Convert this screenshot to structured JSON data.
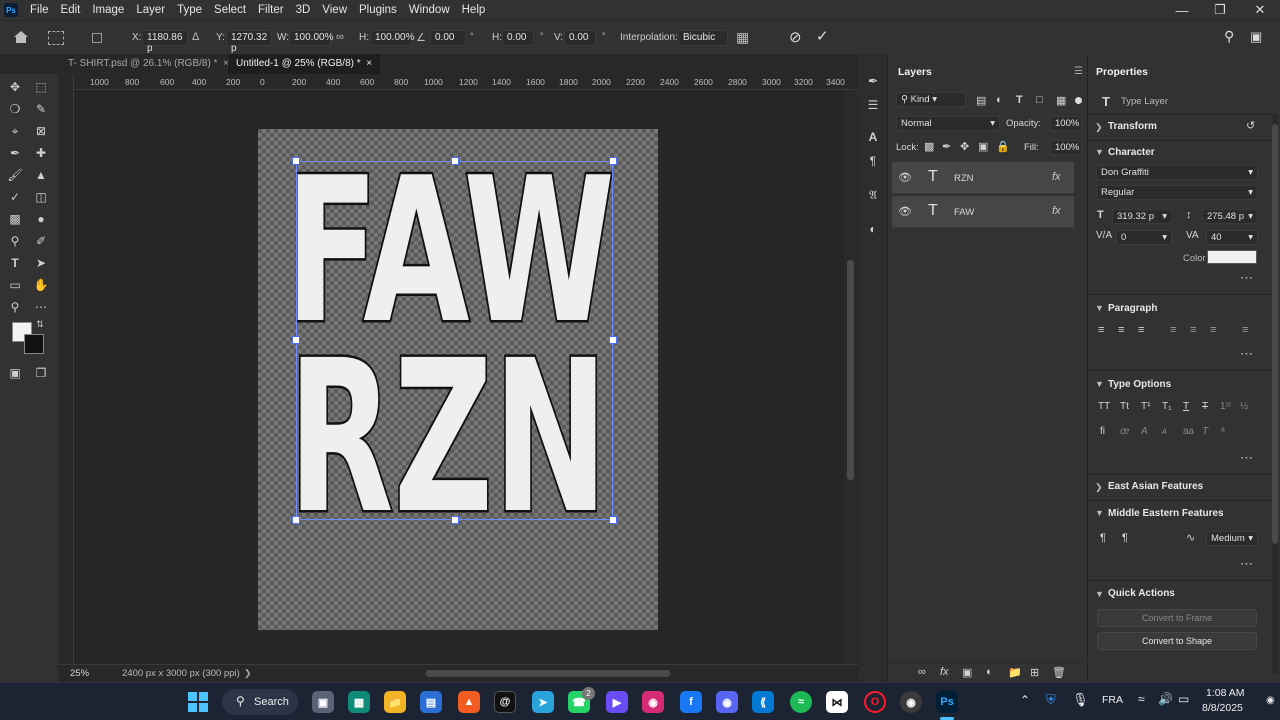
{
  "app": {
    "logo_text": "Ps"
  },
  "menu": [
    "File",
    "Edit",
    "Image",
    "Layer",
    "Type",
    "Select",
    "Filter",
    "3D",
    "View",
    "Plugins",
    "Window",
    "Help"
  ],
  "options_bar": {
    "x_label": "X:",
    "x_value": "1180.86 p",
    "y_label": "Y:",
    "y_value": "1270.32 p",
    "w_label": "W:",
    "w_value": "100.00%",
    "h_label": "H:",
    "h_value": "100.00%",
    "angle_value": "0.00",
    "hskew_label": "H:",
    "hskew_value": "0.00",
    "vskew_label": "V:",
    "vskew_value": "0.00",
    "interp_label": "Interpolation:",
    "interp_value": "Bicubic"
  },
  "tabs": [
    {
      "label": "T- SHIRT.psd @ 26.1% (RGB/8) *",
      "active": false
    },
    {
      "label": "Untitled-1 @ 25% (RGB/8) *",
      "active": true
    }
  ],
  "ruler_labels": [
    "1000",
    "800",
    "600",
    "400",
    "200",
    "0",
    "200",
    "400",
    "600",
    "800",
    "1000",
    "1200",
    "1400",
    "1600",
    "1800",
    "2000",
    "2200",
    "2400",
    "2600",
    "2800",
    "3000",
    "3200",
    "3400"
  ],
  "artwork": {
    "line1": "FAW",
    "line2": "RZN"
  },
  "status": {
    "zoom": "25%",
    "doc_info": "2400 px x 3000 px (300 ppi)"
  },
  "layers_panel": {
    "title": "Layers",
    "filter": "Kind",
    "blend_mode": "Normal",
    "opacity_label": "Opacity:",
    "opacity_value": "100%",
    "lock_label": "Lock:",
    "fill_label": "Fill:",
    "fill_value": "100%",
    "layers": [
      {
        "name": "RZN",
        "fx": "fx"
      },
      {
        "name": "FAW",
        "fx": "fx"
      }
    ]
  },
  "properties_panel": {
    "title": "Properties",
    "layer_type": "Type Layer",
    "transform": "Transform",
    "character": "Character",
    "font_family": "Don Graffiti",
    "font_style": "Regular",
    "font_size": "319.32 p",
    "leading": "275.48 p",
    "kerning": "0",
    "tracking": "40",
    "color_label": "Color",
    "text_color": "#f0f0f0",
    "paragraph": "Paragraph",
    "type_options": "Type Options",
    "east_asian": "East Asian Features",
    "middle_eastern": "Middle Eastern Features",
    "me_value": "Medium",
    "quick_actions": "Quick Actions",
    "convert_frame": "Convert to Frame",
    "convert_shape": "Convert to Shape"
  },
  "taskbar": {
    "search_label": "Search",
    "language": "FRA",
    "time": "1:08 AM",
    "date": "8/8/2025",
    "whatsapp_badge": "2"
  }
}
